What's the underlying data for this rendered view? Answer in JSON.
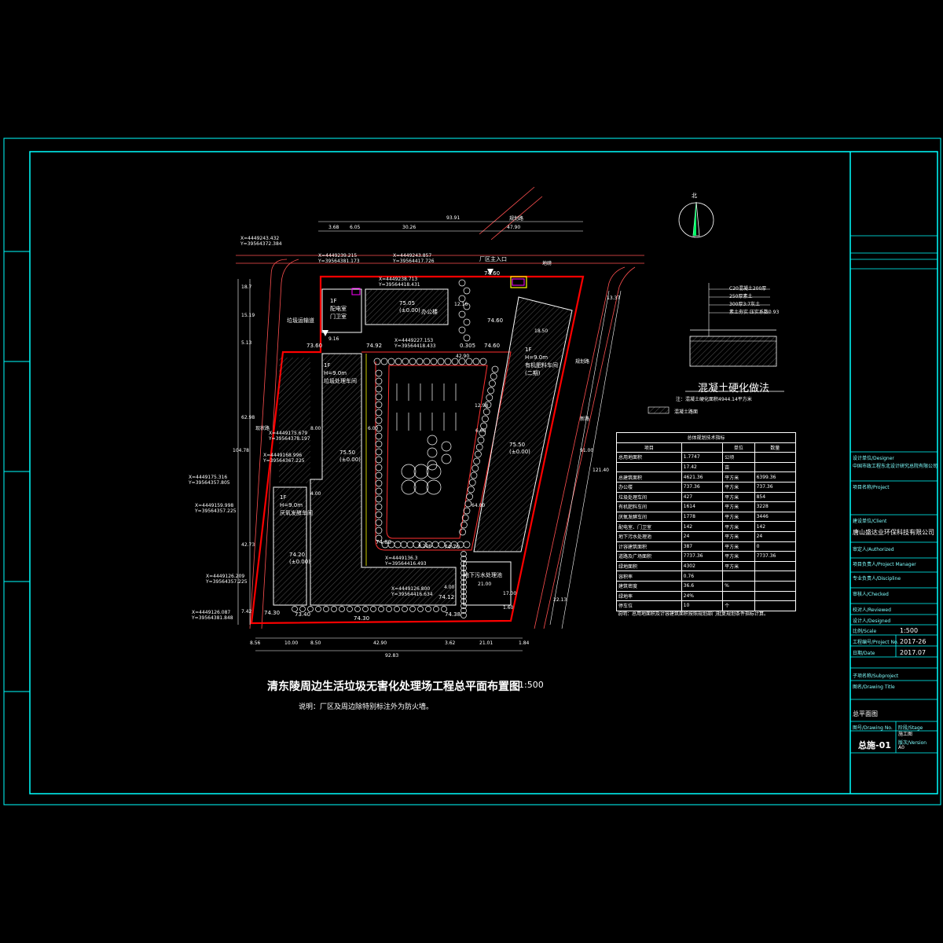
{
  "drawing": {
    "title": "清东陵周边生活垃圾无害化处理场工程总平面布置图",
    "scale": "1:500",
    "note": "说明：厂区及周边除特别标注外为防火墙。"
  },
  "colors": {
    "background": "#000000",
    "frame": "#00ffff",
    "boundary": "#ff0000",
    "building": "#ffffff",
    "road": "#ff5050",
    "green": "#ffffff",
    "yellow": "#ffff00",
    "magenta": "#ff00ff"
  },
  "north_arrow": {
    "label": "北"
  },
  "buildings": [
    {
      "id": "office",
      "lines": [
        "办公楼"
      ],
      "elev": "75.05",
      "elev2": "(±0.00)"
    },
    {
      "id": "guard",
      "lines": [
        "1F",
        "配电室",
        "门卫室"
      ]
    },
    {
      "id": "sorting",
      "lines": [
        "1F",
        "H=9.0m",
        "垃圾处理车间"
      ],
      "elev": "75.50",
      "elev2": "(±0.00)"
    },
    {
      "id": "compost",
      "lines": [
        "1F",
        "H=9.0m",
        "有机肥料车间",
        "(二期)"
      ],
      "elev": "75.50",
      "elev2": "(±0.00)"
    },
    {
      "id": "digester",
      "lines": [
        "1F",
        "H=9.0m",
        "厌氧发酵车间"
      ],
      "elev": "74.20",
      "elev2": "(±0.00)"
    },
    {
      "id": "wastewater",
      "lines": [
        "地下污水处理池"
      ]
    },
    {
      "id": "weighbridge",
      "lines": [
        "地磅"
      ]
    },
    {
      "id": "toilet",
      "lines": [
        "垃圾运输道"
      ]
    }
  ],
  "labels": {
    "main_gate": "厂区主入口",
    "road_north": "规划路",
    "road_east": "规划路",
    "road_west": "现状路",
    "road_se": "新路"
  },
  "coordinates": [
    {
      "x": "X=4449243.432",
      "y": "Y=39564372.384"
    },
    {
      "x": "X=4449239.215",
      "y": "Y=39564381.173"
    },
    {
      "x": "X=4449243.857",
      "y": "Y=39564417.726"
    },
    {
      "x": "X=4449238.713",
      "y": "Y=39564418.431"
    },
    {
      "x": "X=4449227.153",
      "y": "Y=39564418.433"
    },
    {
      "x": "X=4449175.679",
      "y": "Y=39564378.197"
    },
    {
      "x": "X=4449175.316",
      "y": "Y=39564357.805"
    },
    {
      "x": "X=4449168.996",
      "y": "Y=39564367.225"
    },
    {
      "x": "X=4449159.998",
      "y": "Y=39564357.225"
    },
    {
      "x": "X=4449126.209",
      "y": "Y=39564357.225"
    },
    {
      "x": "X=4449126.087",
      "y": "Y=39564381.848"
    },
    {
      "x": "X=4449136.3",
      "y": "Y=39564416.493"
    },
    {
      "x": "X=4449126.800",
      "y": "Y=39564416.634"
    }
  ],
  "dimensions": {
    "top": [
      "93.91",
      "3.68",
      "6.05",
      "30.26",
      "47.90"
    ],
    "bottom": [
      "8.56",
      "10.00",
      "8.50",
      "42.90",
      "3.62",
      "21.01",
      "1.84",
      "92.83"
    ],
    "left": [
      "18.7",
      "15.19",
      "5.13",
      "62.98",
      "104.78",
      "42.73",
      "7.42"
    ],
    "right": [
      "13.37",
      "91.00",
      "121.40",
      "22.13"
    ],
    "internal": [
      "9.16",
      "12.16",
      "42.90",
      "6.00",
      "8.00",
      "8.206",
      "21.00",
      "17.00",
      "4.00",
      "1.60",
      "4.00",
      "6.00",
      "12.98",
      "18.50",
      "64.00"
    ]
  },
  "elevations": [
    "74.60",
    "74.60",
    "73.60",
    "74.92",
    "0.305",
    "74.80",
    "74.70",
    "74.30",
    "74.30",
    "73.40",
    "74.38",
    "74.12",
    "74.60"
  ],
  "hardening": {
    "title": "混凝土硬化做法",
    "layers": [
      "C20混凝土200厚",
      "250厚素土",
      "300厚3:7灰土",
      "素土夯实 压实系数0.93"
    ],
    "legend_note": "注：混凝土硬化面积4944.14平方米",
    "legend_item": "混凝土路面"
  },
  "econ_table": {
    "title": "总体规划技术指标",
    "header": [
      "项目",
      "",
      "单位",
      "数量"
    ],
    "rows": [
      [
        "总用地面积",
        "1.7747",
        "公顷",
        ""
      ],
      [
        "",
        "17.42",
        "亩",
        ""
      ],
      [
        "总建筑面积",
        "4621.36",
        "平方米",
        "6399.36"
      ],
      [
        "办公楼",
        "737.36",
        "平方米",
        "737.36"
      ],
      [
        "垃圾处理车间",
        "427",
        "平方米",
        "854"
      ],
      [
        "有机肥料车间",
        "1614",
        "平方米",
        "3228"
      ],
      [
        "厌氧发酵车间",
        "1778",
        "平方米",
        "3446"
      ],
      [
        "配电室、门卫室",
        "142",
        "平方米",
        "142"
      ],
      [
        "地下污水处理池",
        "24",
        "平方米",
        "24"
      ],
      [
        "计容建筑面积",
        "387",
        "平方米",
        "0"
      ],
      [
        "道路及广场面积",
        "7737.36",
        "平方米",
        "7737.36"
      ],
      [
        "绿地面积",
        "4302",
        "平方米",
        ""
      ],
      [
        "容积率",
        "0.76",
        "",
        ""
      ],
      [
        "建筑密度",
        "36.6",
        "%",
        ""
      ],
      [
        "绿地率",
        "24%",
        "",
        ""
      ],
      [
        "停车位",
        "10",
        "个",
        ""
      ]
    ],
    "note": "说明：总用地面积及计容建筑面积按照规划部门批复规划条件指标计算。"
  },
  "title_block": {
    "designer_company_label": "设计单位/Designer",
    "designer_company": "中国市政工程东北设计研究总院有限公司",
    "project_label": "项目名称/Project",
    "client_label": "建设单位/Client",
    "client": "唐山盛达业环保科技有限公司",
    "row_labels": [
      "审定人/Authorized",
      "项目负责人/Project Manager",
      "专业负责人/Discipline",
      "审核人/Checked",
      "校对人/Reviewed",
      "设计人/Designed",
      "比例/Scale",
      "工程编号/Project No.",
      "日期/Date"
    ],
    "scale": "1:500",
    "project_no": "2017-26",
    "date": "2017.07",
    "subproject_label": "子项名称/Subproject",
    "drawing_title_label": "图名/Drawing Title",
    "drawing_title": "总平面图",
    "drawing_no_label": "图号/Drawing No.",
    "drawing_no": "总施-01",
    "stage_label": "阶段/Stage",
    "stage": "施工图",
    "version_label": "版次/Version",
    "version": "A0"
  }
}
